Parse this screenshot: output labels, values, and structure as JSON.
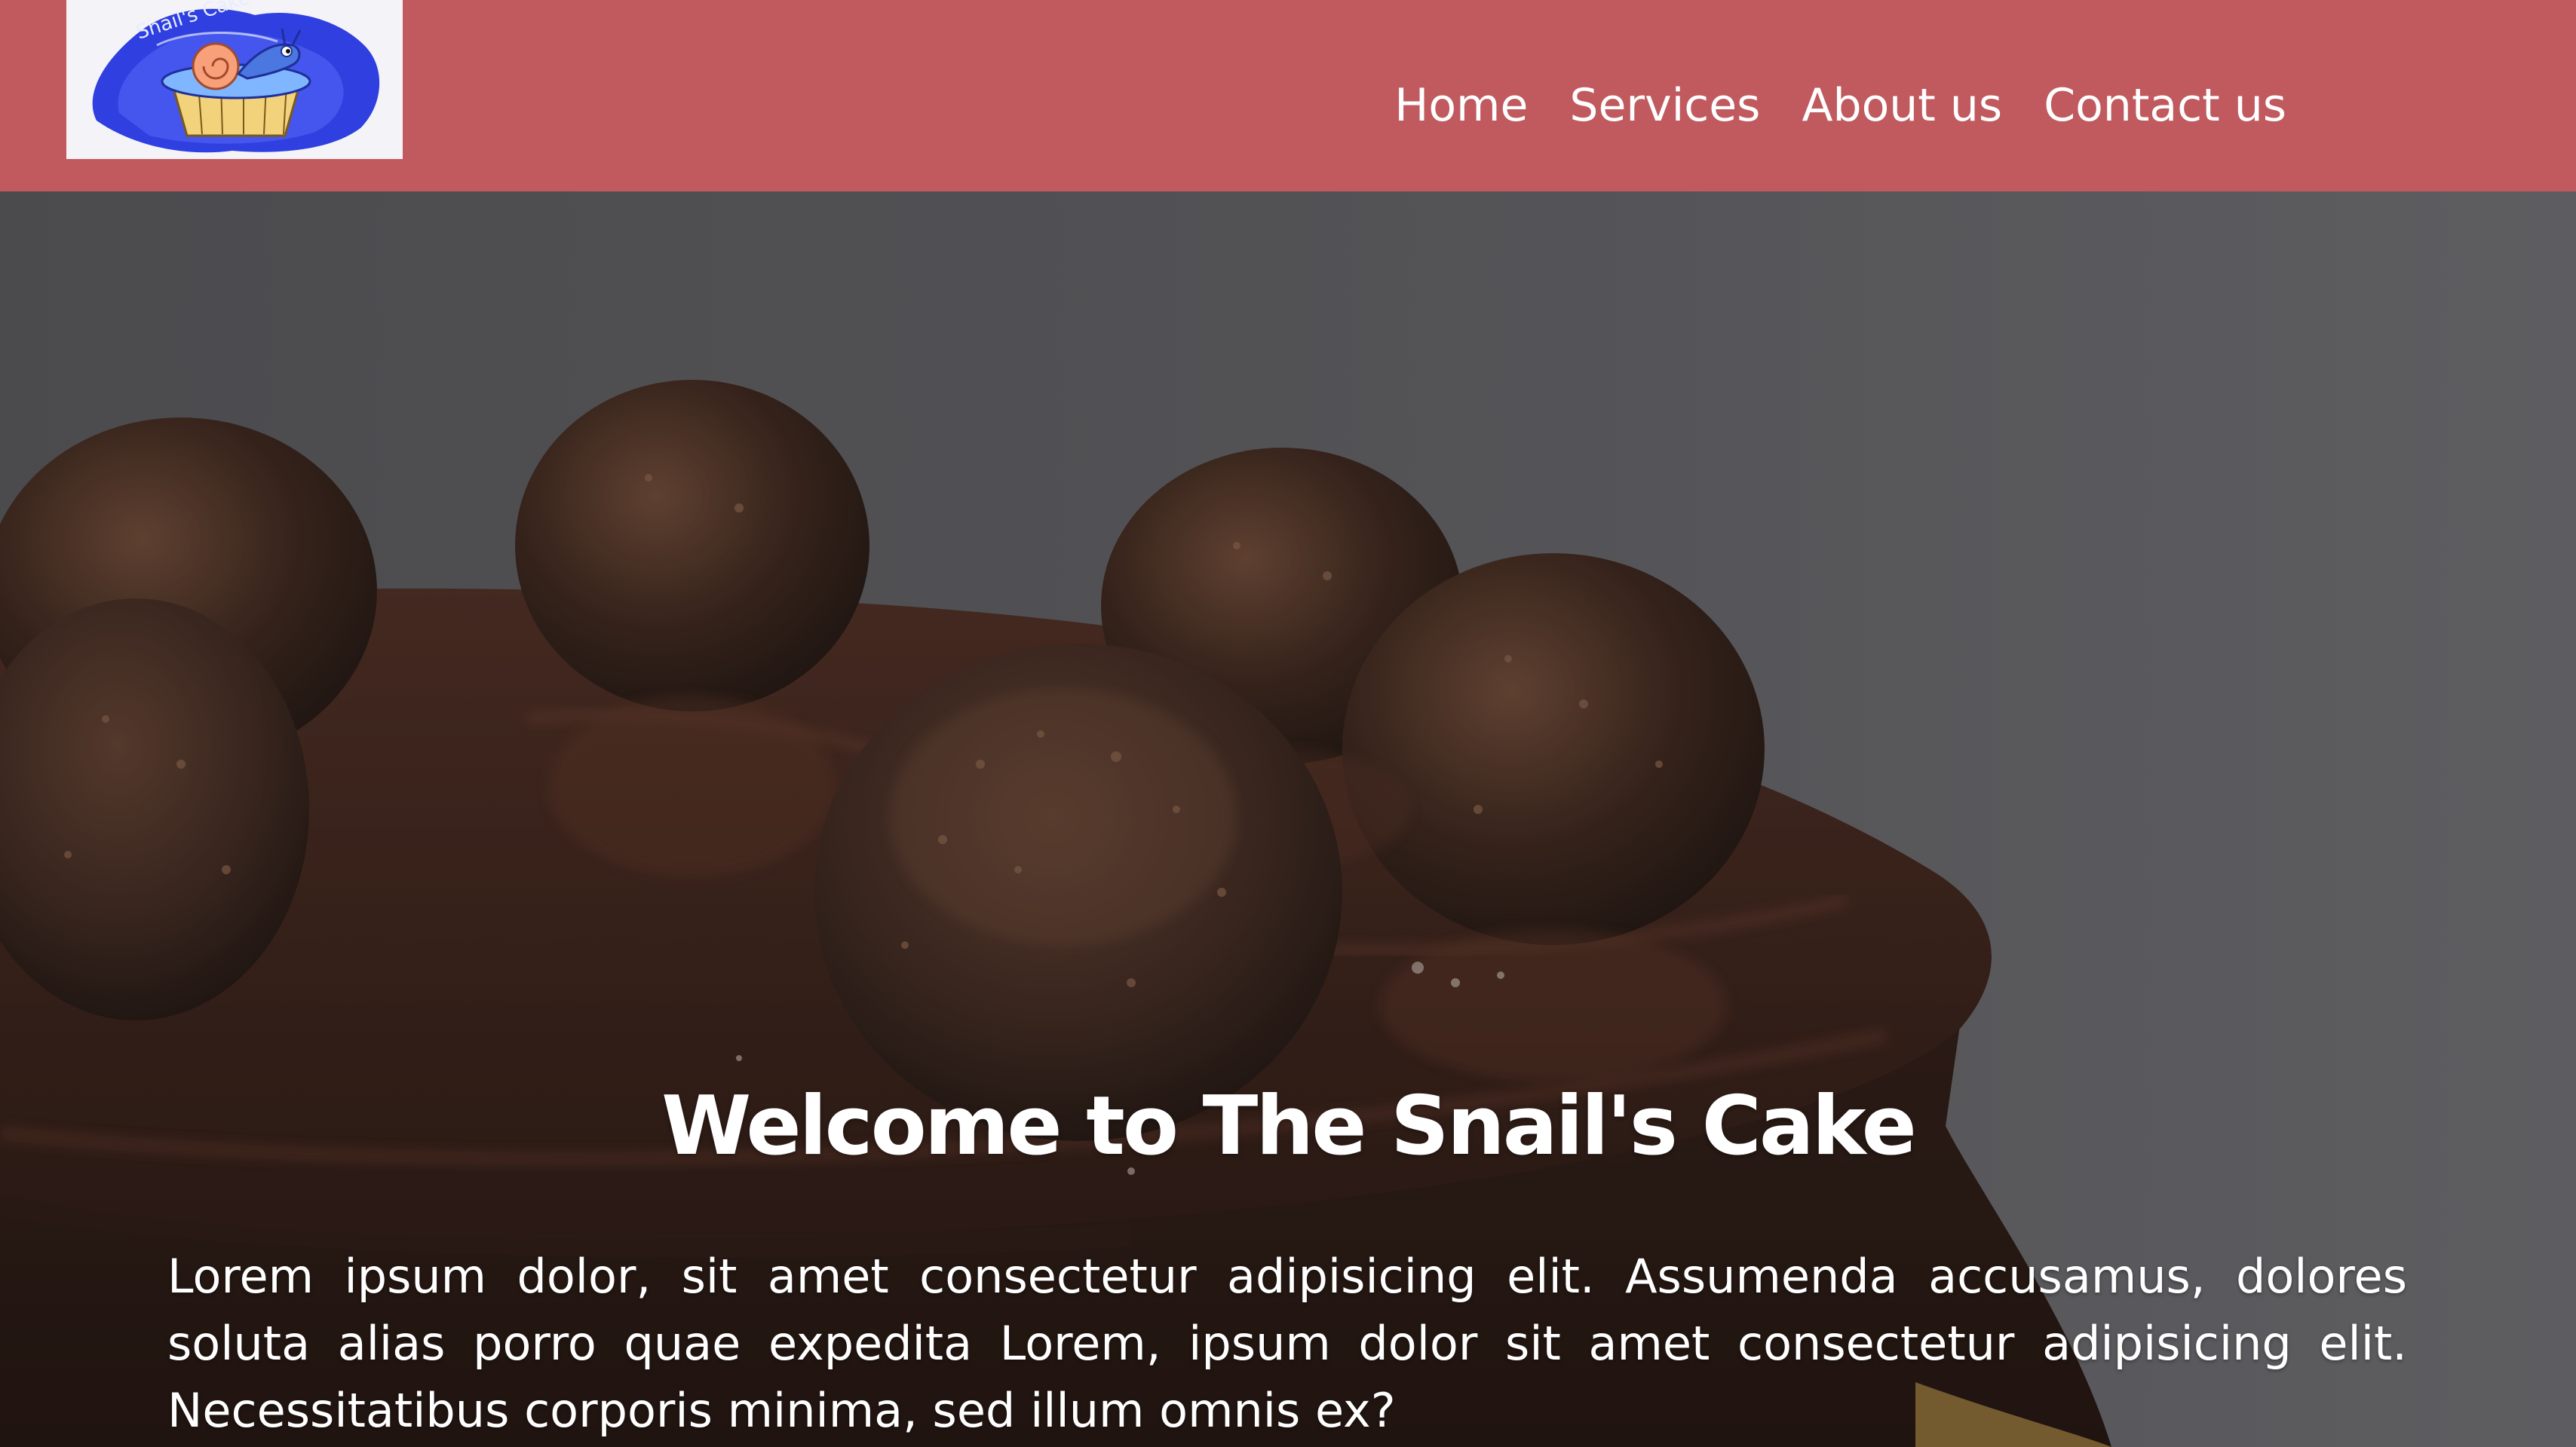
{
  "header": {
    "logo_label": "Snail's Cake",
    "nav": {
      "home": "Home",
      "services": "Services",
      "about": "About us",
      "contact": "Contact us"
    },
    "background_color": "#c05a5e"
  },
  "hero": {
    "title": "Welcome to The Snail's Cake",
    "description": "Lorem ipsum dolor, sit amet consectetur adipisicing elit. Assumenda accusamus, dolores soluta alias porro quae expedita Lorem, ipsum dolor sit amet consectetur adipisicing elit. Necessitatibus corporis minima, sed illum omnis ex?",
    "background_image": "chocolate-cake-with-truffles"
  }
}
